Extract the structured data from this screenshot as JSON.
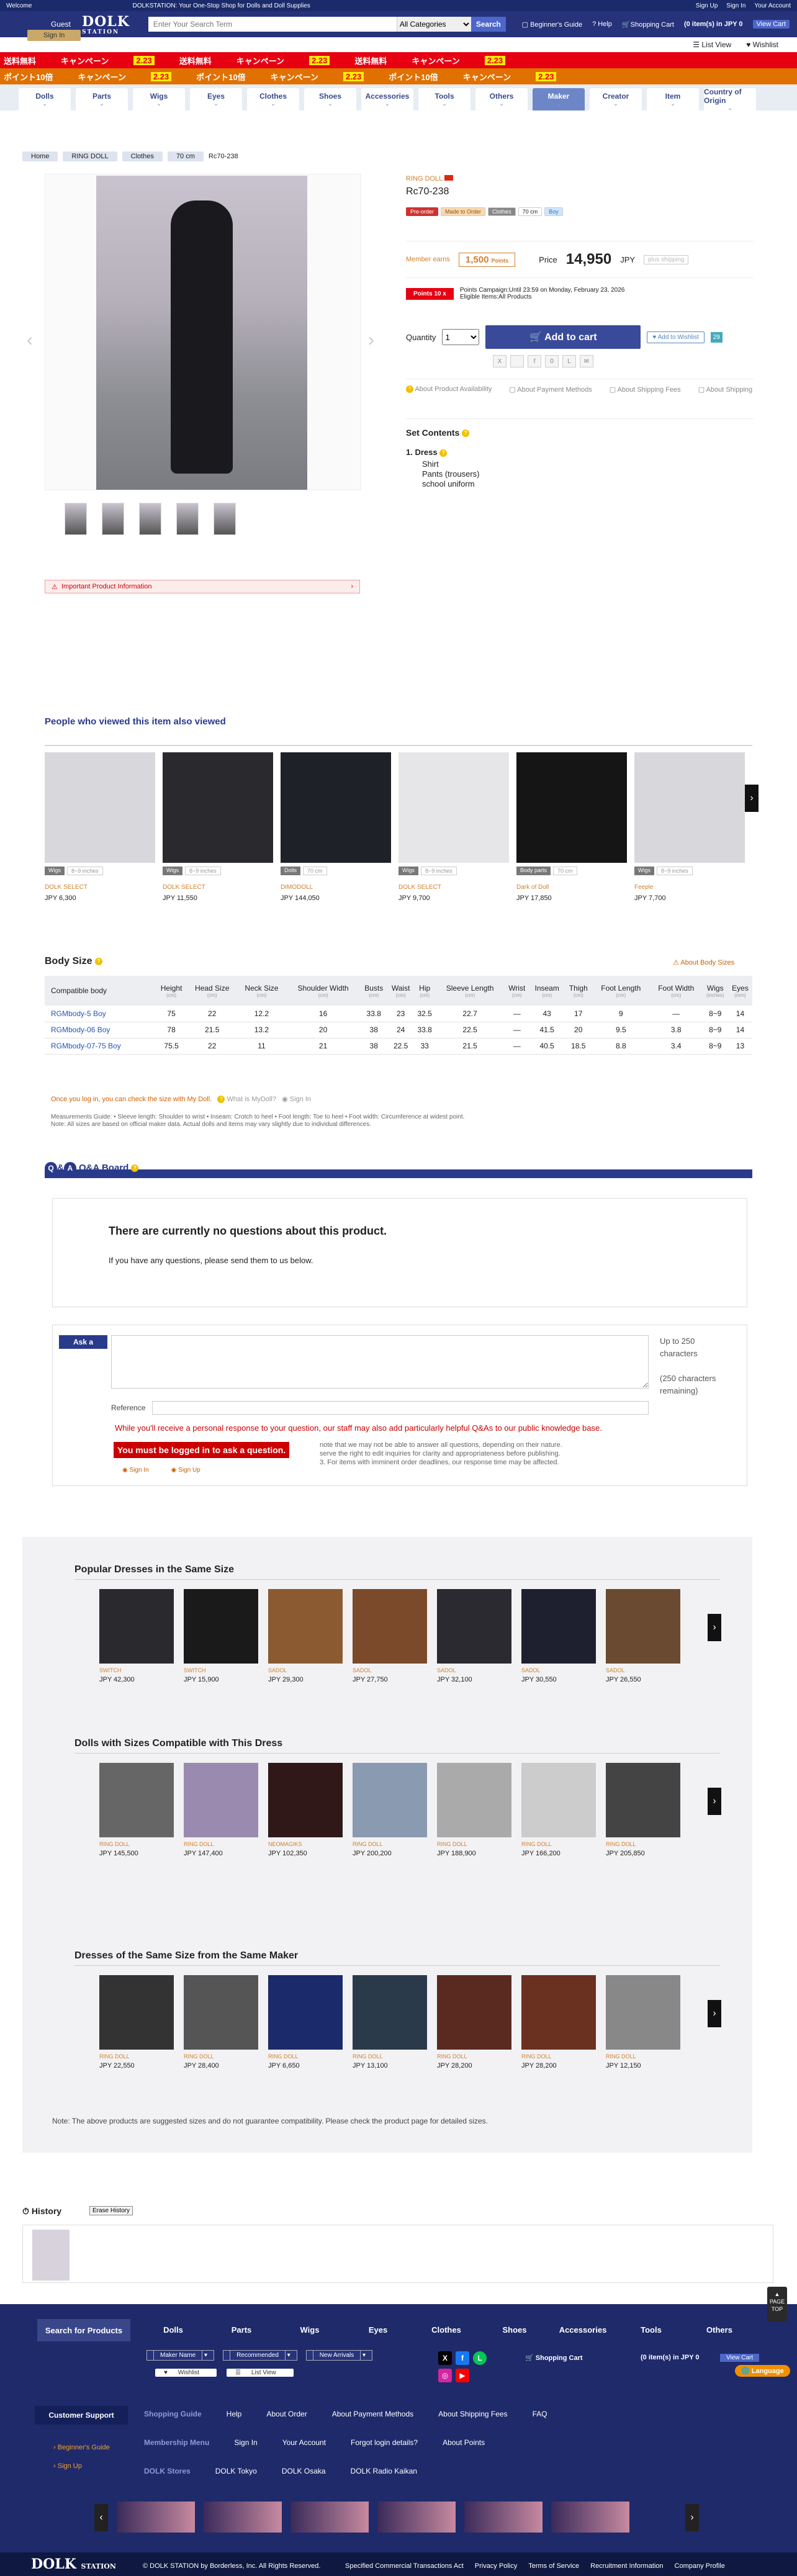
{
  "topbar": {
    "welcome": "Welcome",
    "tagline": "DOLKSTATION: Your One-Stop Shop for Dolls and Doll Supplies",
    "signup": "Sign Up",
    "signin": "Sign In",
    "account": "Your Account"
  },
  "header": {
    "guest": "Guest",
    "logo": "DOLK",
    "logo_sub": "STATION",
    "signin_btn": "Sign In",
    "search_placeholder": "Enter Your Search Term",
    "category": "All Categories",
    "search_btn": "Search",
    "beginners": "Beginner's Guide",
    "help": "Help",
    "cart": "Shopping Cart",
    "cart_items": "(0 item(s) in JPY 0",
    "view_cart": "View Cart",
    "list_view": "List View",
    "wishlist": "Wishlist"
  },
  "banner": {
    "r1": [
      "送料無料",
      "キャンペーン",
      "2.23",
      "送料無料",
      "キャンペーン",
      "2.23",
      "送料無料",
      "キャンペーン",
      "2.23"
    ],
    "r2": [
      "ポイント10倍",
      "キャンペーン",
      "2.23",
      "ポイント10倍",
      "キャンペーン",
      "2.23",
      "ポイント10倍",
      "キャンペーン",
      "2.23"
    ]
  },
  "nav": [
    "Dolls",
    "Parts",
    "Wigs",
    "Eyes",
    "Clothes",
    "Shoes",
    "Accessories",
    "Tools",
    "Others",
    "Maker",
    "Creator",
    "Item",
    "Country of Origin"
  ],
  "breadcrumb": [
    "Home",
    "RING DOLL",
    "Clothes",
    "70 cm",
    "Rc70-238"
  ],
  "product": {
    "maker": "RING DOLL",
    "code": "Rc70-238",
    "tags": [
      "Pre-order",
      "Made to Order",
      "Clothes",
      "70 cm",
      "Boy"
    ],
    "member_label": "Member earns",
    "points": "1,500",
    "points_unit": "Points",
    "price_label": "Price",
    "price": "14,950",
    "currency": "JPY",
    "shipping": "plus shipping",
    "campaign_badge": "Points 10 x",
    "campaign_line1": "Points Campaign:Until 23:59 on Monday, February 23, 2026",
    "campaign_line2": "Eligible Items:All Products",
    "qty_label": "Quantity",
    "qty": "1",
    "add_cart": "Add to cart",
    "add_wishlist": "Add to Wishlist",
    "wish_count": "29",
    "link_availability": "About Product Availability",
    "link_payment": "About Payment Methods",
    "link_fees": "About Shipping Fees",
    "link_shipping": "About Shipping",
    "set_contents": "Set Contents",
    "dress_title": "1. Dress",
    "dress_items": [
      "Shirt",
      "Pants (trousers)",
      "school uniform"
    ],
    "important": "Important Product Information"
  },
  "viewed": {
    "title": "People who viewed this item also viewed",
    "items": [
      {
        "tag": "Wigs",
        "sub": "8~9 inches",
        "maker": "DOLK SELECT",
        "price": "JPY 6,300"
      },
      {
        "tag": "Wigs",
        "sub": "8~9 inches",
        "maker": "DOLK SELECT",
        "price": "JPY 11,550"
      },
      {
        "tag": "Dolls",
        "sub": "70 cm",
        "maker": "DIMODOLL",
        "price": "JPY 144,050"
      },
      {
        "tag": "Wigs",
        "sub": "8~9 inches",
        "maker": "DOLK SELECT",
        "price": "JPY 9,700"
      },
      {
        "tag": "Body parts",
        "sub": "70 cm",
        "maker": "Dark of Doll",
        "price": "JPY 17,850"
      },
      {
        "tag": "Wigs",
        "sub": "8~9 inches",
        "maker": "Feeple",
        "price": "JPY 7,700"
      }
    ]
  },
  "body_size": {
    "title": "Body Size",
    "about": "About Body Sizes",
    "headers": [
      "Compatible body",
      "Height",
      "Head Size",
      "Neck Size",
      "Shoulder Width",
      "Busts",
      "Waist",
      "Hip",
      "Sleeve Length",
      "Wrist",
      "Inseam",
      "Thigh",
      "Foot Length",
      "Foot Width",
      "Wigs",
      "Eyes"
    ],
    "units": [
      "",
      "(cm)",
      "(cm)",
      "(cm)",
      "(cm)",
      "(cm)",
      "(cm)",
      "(cm)",
      "(cm)",
      "(cm)",
      "(cm)",
      "(cm)",
      "(cm)",
      "(cm)",
      "(inches)",
      "(mm)"
    ],
    "rows": [
      [
        "RGMbody-5 Boy",
        "75",
        "22",
        "12.2",
        "16",
        "33.8",
        "23",
        "32.5",
        "22.7",
        "—",
        "43",
        "17",
        "9",
        "—",
        "8~9",
        "14"
      ],
      [
        "RGMbody-06 Boy",
        "78",
        "21.5",
        "13.2",
        "20",
        "38",
        "24",
        "33.8",
        "22.5",
        "—",
        "41.5",
        "20",
        "9.5",
        "3.8",
        "8~9",
        "14"
      ],
      [
        "RGMbody-07-75 Boy",
        "75.5",
        "22",
        "11",
        "21",
        "38",
        "22.5",
        "33",
        "21.5",
        "—",
        "40.5",
        "18.5",
        "8.8",
        "3.4",
        "8~9",
        "13"
      ]
    ],
    "note_login": "Once you log in, you can check the size with My Doll.",
    "note_mydoll": "What is MyDoll?",
    "note_signin": "Sign In",
    "note_guide": "Measurements Guide: • Sleeve length: Shoulder to wrist • Inseam: Crotch to heel • Foot length: Toe to heel • Foot width: Circumference at widest point.",
    "note_official": "Note: All sizes are based on official maker data. Actual dolls and items may vary slightly due to individual differences."
  },
  "qa": {
    "title": "Q&A Board",
    "sub": "Q&A Board",
    "empty_title": "There are currently no questions about this product.",
    "empty_text": "If you have any questions, please send them to us below.",
    "ask": "Ask a",
    "count": "Up to 250 characters",
    "remaining": "(250 characters remaining)",
    "reference": "Reference",
    "note": "While you'll receive a personal response to your question, our staff may also add particularly helpful Q&As to our public knowledge base.",
    "must_login": "You must be logged in to ask a question.",
    "note2": "note that we may not be able to answer all questions, depending on their nature.",
    "note3": "serve the right to edit inquiries for clarity and appropriateness before publishing.",
    "note4": "3. For items with imminent order deadlines, our response time may be affected.",
    "signin": "Sign In",
    "signup": "Sign Up"
  },
  "related": [
    {
      "title": "Popular Dresses in the Same Size",
      "items": [
        {
          "maker": "SWITCH",
          "price": "JPY 42,300"
        },
        {
          "maker": "SWITCH",
          "price": "JPY 15,900"
        },
        {
          "maker": "SADOL",
          "price": "JPY 29,300"
        },
        {
          "maker": "SADOL",
          "price": "JPY 27,750"
        },
        {
          "maker": "SADOL",
          "price": "JPY 32,100"
        },
        {
          "maker": "SADOL",
          "price": "JPY 30,550"
        },
        {
          "maker": "SADOL",
          "price": "JPY 26,550"
        }
      ]
    },
    {
      "title": "Dolls with Sizes Compatible with This Dress",
      "items": [
        {
          "maker": "RING DOLL",
          "price": "JPY 145,500"
        },
        {
          "maker": "RING DOLL",
          "price": "JPY 147,400"
        },
        {
          "maker": "NEOMAGIKS",
          "price": "JPY 102,350"
        },
        {
          "maker": "RING DOLL",
          "price": "JPY 200,200"
        },
        {
          "maker": "RING DOLL",
          "price": "JPY 188,900"
        },
        {
          "maker": "RING DOLL",
          "price": "JPY 166,200"
        },
        {
          "maker": "RING DOLL",
          "price": "JPY 205,850"
        }
      ]
    },
    {
      "title": "Dresses of the Same Size from the Same Maker",
      "items": [
        {
          "maker": "RING DOLL",
          "price": "JPY 22,550"
        },
        {
          "maker": "RING DOLL",
          "price": "JPY 28,400"
        },
        {
          "maker": "RING DOLL",
          "price": "JPY 6,650"
        },
        {
          "maker": "RING DOLL",
          "price": "JPY 13,100"
        },
        {
          "maker": "RING DOLL",
          "price": "JPY 28,200"
        },
        {
          "maker": "RING DOLL",
          "price": "JPY 28,200"
        },
        {
          "maker": "RING DOLL",
          "price": "JPY 12,150"
        }
      ]
    }
  ],
  "related_note": "Note: The above products are suggested sizes and do not guarantee compatibility. Please check the product page for detailed sizes.",
  "history": {
    "title": "History",
    "erase": "Erase History"
  },
  "footer": {
    "search_for": "Search for Products",
    "cats": [
      "Dolls",
      "Parts",
      "Wigs",
      "Eyes",
      "Clothes",
      "Shoes",
      "Accessories",
      "Tools",
      "Others"
    ],
    "maker": "Maker Name",
    "recommended": "Recommended",
    "new": "New Arrivals",
    "wishlist": "Wishlist",
    "list_view": "List View",
    "cart": "Shopping Cart",
    "cart_items": "(0 item(s) in JPY 0",
    "view_cart": "View Cart",
    "language": "Language",
    "page_top": "PAGE TOP",
    "support": "Customer Support",
    "guide_h": "Shopping Guide",
    "guide": [
      "Help",
      "About Order",
      "About Payment Methods",
      "About Shipping Fees",
      "FAQ"
    ],
    "member_h": "Membership Menu",
    "member": [
      "Sign In",
      "Your Account",
      "Forgot login details?",
      "About Points"
    ],
    "stores_h": "DOLK Stores",
    "stores": [
      "DOLK Tokyo",
      "DOLK Osaka",
      "DOLK Radio Kaikan"
    ],
    "side": [
      "Beginner's Guide",
      "Sign Up"
    ],
    "copy": "© DOLK STATION by Borderless, Inc. All Rights Reserved.",
    "links": [
      "Specified Commercial Transactions Act",
      "Privacy Policy",
      "Terms of Service",
      "Recruitment Information",
      "Company Profile"
    ]
  }
}
